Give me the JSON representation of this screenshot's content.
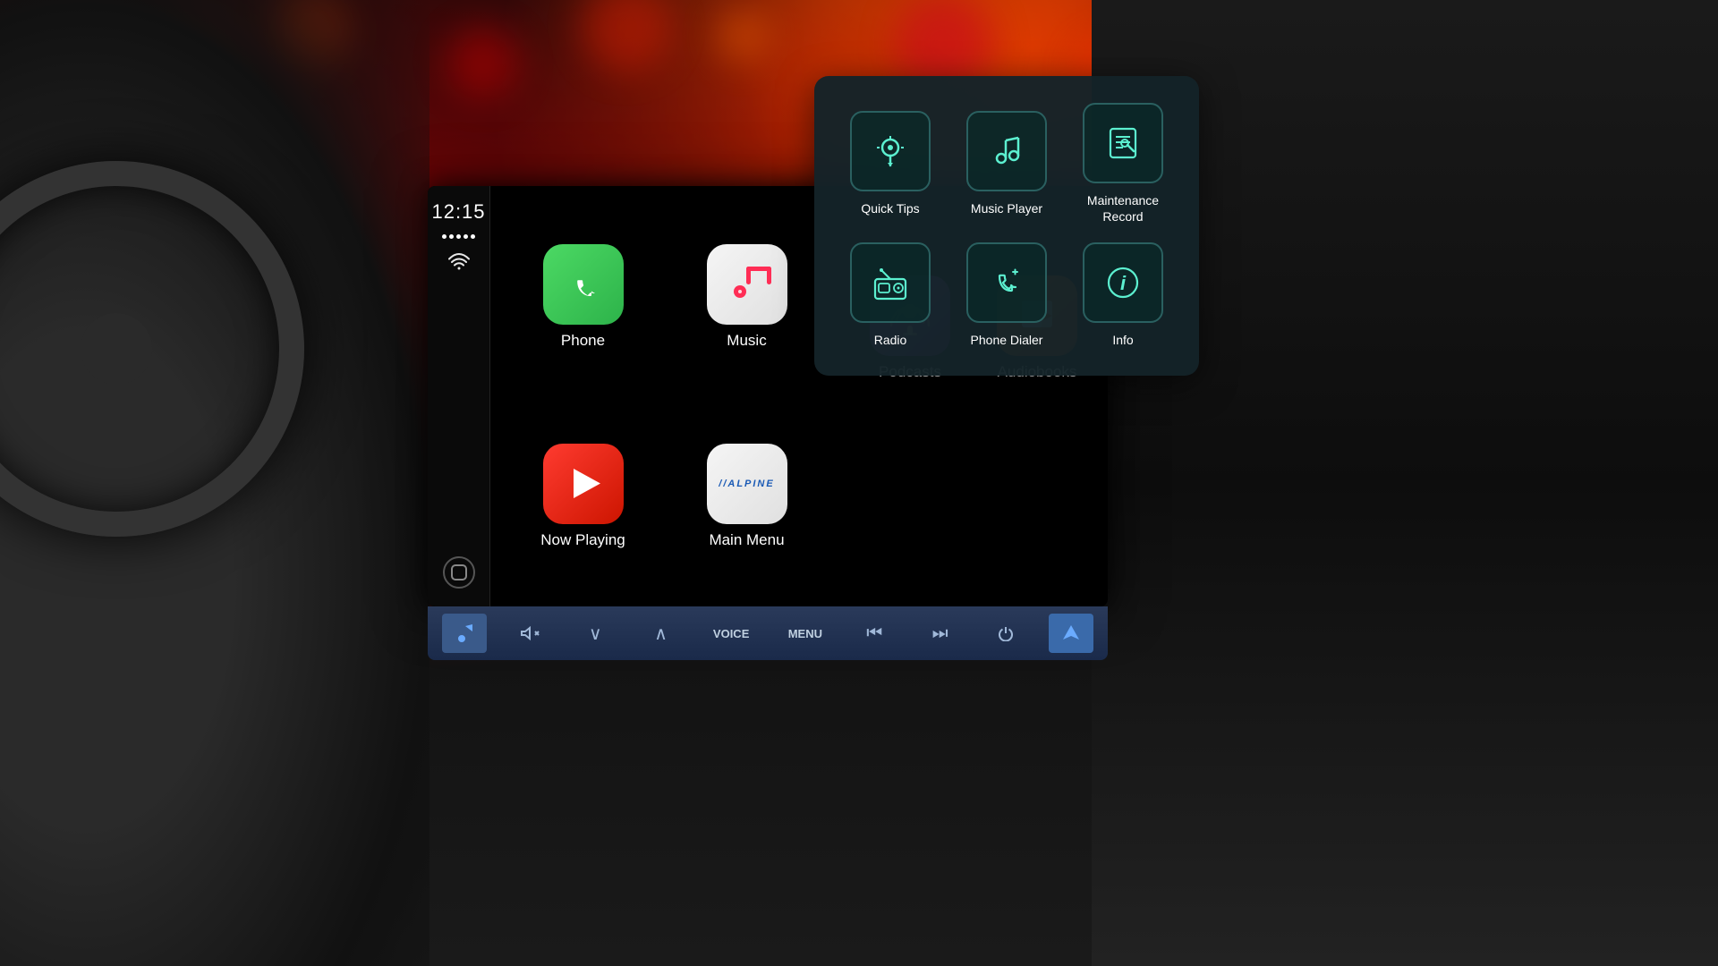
{
  "background": {
    "description": "Car interior with bokeh lights background"
  },
  "time": "12:15",
  "screen": {
    "apps": [
      {
        "id": "phone",
        "label": "Phone",
        "icon": "phone",
        "color_start": "#4cd964",
        "color_end": "#2db34a"
      },
      {
        "id": "music",
        "label": "Music",
        "icon": "music",
        "color_start": "#f5f5f5",
        "color_end": "#e0e0e0"
      },
      {
        "id": "now-playing",
        "label": "Now Playing",
        "icon": "now-playing",
        "color_start": "#ff3b30",
        "color_end": "#cc1500"
      },
      {
        "id": "main-menu",
        "label": "Main Menu",
        "icon": "alpine",
        "color_start": "#f5f5f5",
        "color_end": "#e0e0e0"
      }
    ],
    "side_apps": [
      {
        "id": "podcasts",
        "label": "Podcasts",
        "icon": "podcasts"
      },
      {
        "id": "audiobooks",
        "label": "Audiobooks",
        "icon": "audiobooks"
      }
    ],
    "controls": [
      {
        "id": "music-ctrl",
        "icon": "♪",
        "active": true
      },
      {
        "id": "mute",
        "icon": "🔇",
        "active": false
      },
      {
        "id": "down",
        "icon": "∨",
        "active": false
      },
      {
        "id": "up",
        "icon": "∧",
        "active": false
      },
      {
        "id": "voice",
        "label": "VOICE",
        "active": false
      },
      {
        "id": "menu",
        "label": "MENU",
        "active": false
      },
      {
        "id": "prev",
        "icon": "⏮",
        "active": false
      },
      {
        "id": "next",
        "icon": "⏭",
        "active": false
      },
      {
        "id": "power",
        "icon": "⏻",
        "active": false
      },
      {
        "id": "nav",
        "icon": "▲",
        "active": true
      }
    ]
  },
  "popup": {
    "items": [
      {
        "id": "quick-tips",
        "label": "Quick Tips",
        "icon": "💡"
      },
      {
        "id": "music-player",
        "label": "Music Player",
        "icon": "♪"
      },
      {
        "id": "maintenance-record",
        "label": "Maintenance\nRecord",
        "icon": "⚙"
      },
      {
        "id": "radio",
        "label": "Radio",
        "icon": "📺"
      },
      {
        "id": "phone-dialer",
        "label": "Phone Dialer",
        "icon": "📞"
      },
      {
        "id": "info",
        "label": "Info",
        "icon": "ℹ"
      }
    ]
  }
}
